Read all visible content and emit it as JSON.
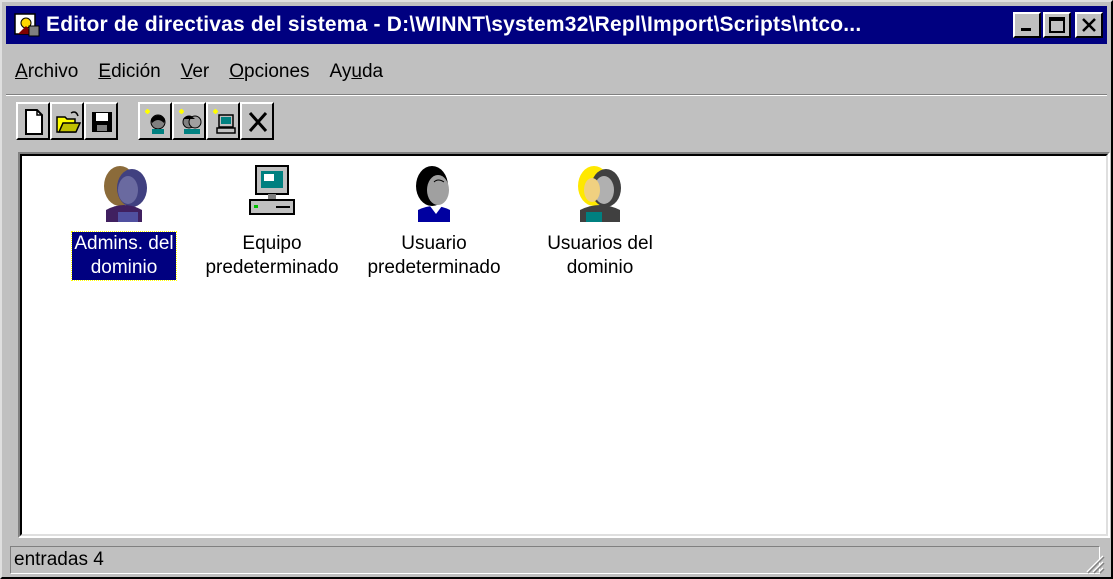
{
  "window": {
    "title": "Editor de directivas del sistema - D:\\WINNT\\system32\\Repl\\Import\\Scripts\\ntco..."
  },
  "menu": [
    {
      "label": "Archivo",
      "mnemonic": "A"
    },
    {
      "label": "Edición",
      "mnemonic": "E"
    },
    {
      "label": "Ver",
      "mnemonic": "V"
    },
    {
      "label": "Opciones",
      "mnemonic": "O"
    },
    {
      "label": "Ayuda",
      "mnemonic": "u"
    }
  ],
  "toolbar": [
    "new-file-icon",
    "open-folder-icon",
    "save-icon",
    "add-user-icon",
    "add-group-icon",
    "add-computer-icon",
    "delete-icon"
  ],
  "items": [
    {
      "line1": "Admins. del",
      "line2": "dominio",
      "selected": true,
      "icon": "admins-group-icon"
    },
    {
      "line1": "Equipo",
      "line2": "predeterminado",
      "selected": false,
      "icon": "computer-icon"
    },
    {
      "line1": "Usuario",
      "line2": "predeterminado",
      "selected": false,
      "icon": "user-icon"
    },
    {
      "line1": "Usuarios del",
      "line2": "dominio",
      "selected": false,
      "icon": "users-group-icon"
    }
  ],
  "status": {
    "text": "entradas 4"
  },
  "colors": {
    "titlebar": "#000080",
    "selection": "#000080",
    "face": "#c0c0c0"
  }
}
